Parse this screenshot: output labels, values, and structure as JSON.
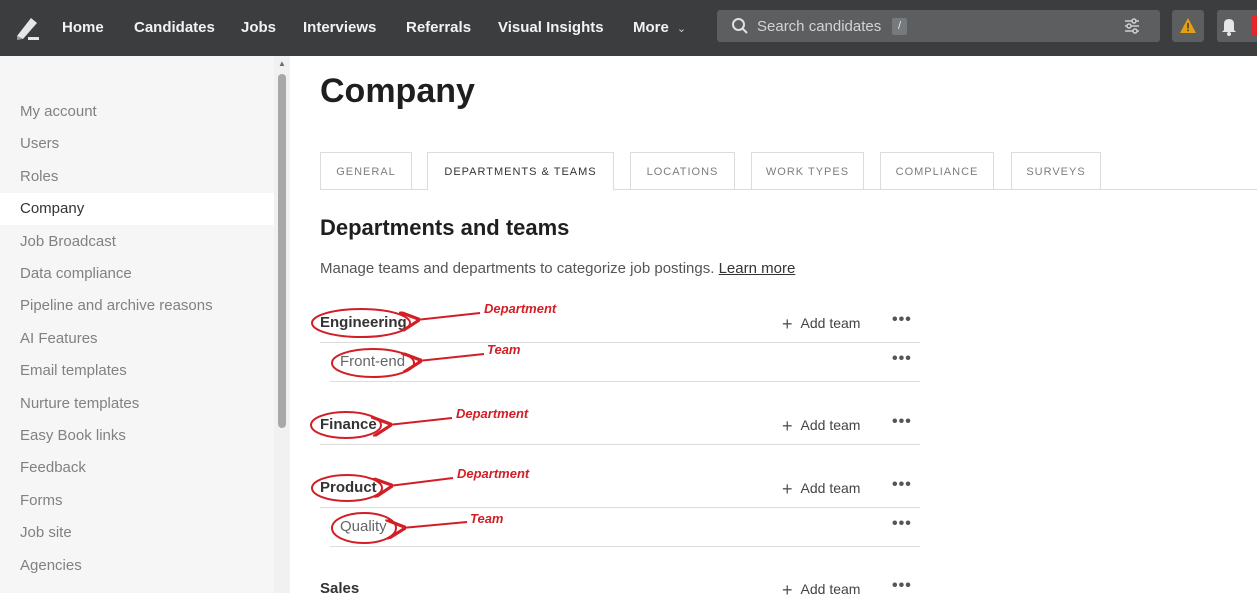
{
  "nav": {
    "items": [
      "Home",
      "Candidates",
      "Jobs",
      "Interviews",
      "Referrals",
      "Visual Insights",
      "More"
    ],
    "search_placeholder": "Search candidates",
    "search_shortcut": "/",
    "icons": [
      "logo-icon",
      "search-icon",
      "filter-icon",
      "warning-icon",
      "bell-icon"
    ],
    "colors": {
      "bar": "#3b3d3f",
      "warning": "#e5a00d",
      "badge": "#e2262b"
    }
  },
  "sidebar": {
    "items": [
      {
        "label": "My account"
      },
      {
        "label": "Users"
      },
      {
        "label": "Roles"
      },
      {
        "label": "Company"
      },
      {
        "label": "Job Broadcast"
      },
      {
        "label": "Data compliance"
      },
      {
        "label": "Pipeline and archive reasons"
      },
      {
        "label": "AI Features"
      },
      {
        "label": "Email templates"
      },
      {
        "label": "Nurture templates"
      },
      {
        "label": "Easy Book links"
      },
      {
        "label": "Feedback"
      },
      {
        "label": "Forms"
      },
      {
        "label": "Job site"
      },
      {
        "label": "Agencies"
      }
    ],
    "active": "Company"
  },
  "main": {
    "title": "Company",
    "tabs": [
      {
        "label": "GENERAL"
      },
      {
        "label": "DEPARTMENTS & TEAMS"
      },
      {
        "label": "LOCATIONS"
      },
      {
        "label": "WORK TYPES"
      },
      {
        "label": "COMPLIANCE"
      },
      {
        "label": "SURVEYS"
      }
    ],
    "active_tab": "DEPARTMENTS & TEAMS",
    "section_title": "Departments and teams",
    "section_desc": "Manage teams and departments to categorize job postings.",
    "learn_more": "Learn more",
    "add_team_label": "Add team",
    "more_label": "•••",
    "rows": [
      {
        "type": "department",
        "name": "Engineering"
      },
      {
        "type": "team",
        "name": "Front-end"
      },
      {
        "type": "department",
        "name": "Finance"
      },
      {
        "type": "department",
        "name": "Product"
      },
      {
        "type": "team",
        "name": "Quality"
      },
      {
        "type": "department",
        "name": "Sales"
      }
    ]
  },
  "annotations": {
    "labels": [
      "Department",
      "Team",
      "Department",
      "Department",
      "Team"
    ],
    "color": "#d21f26"
  }
}
